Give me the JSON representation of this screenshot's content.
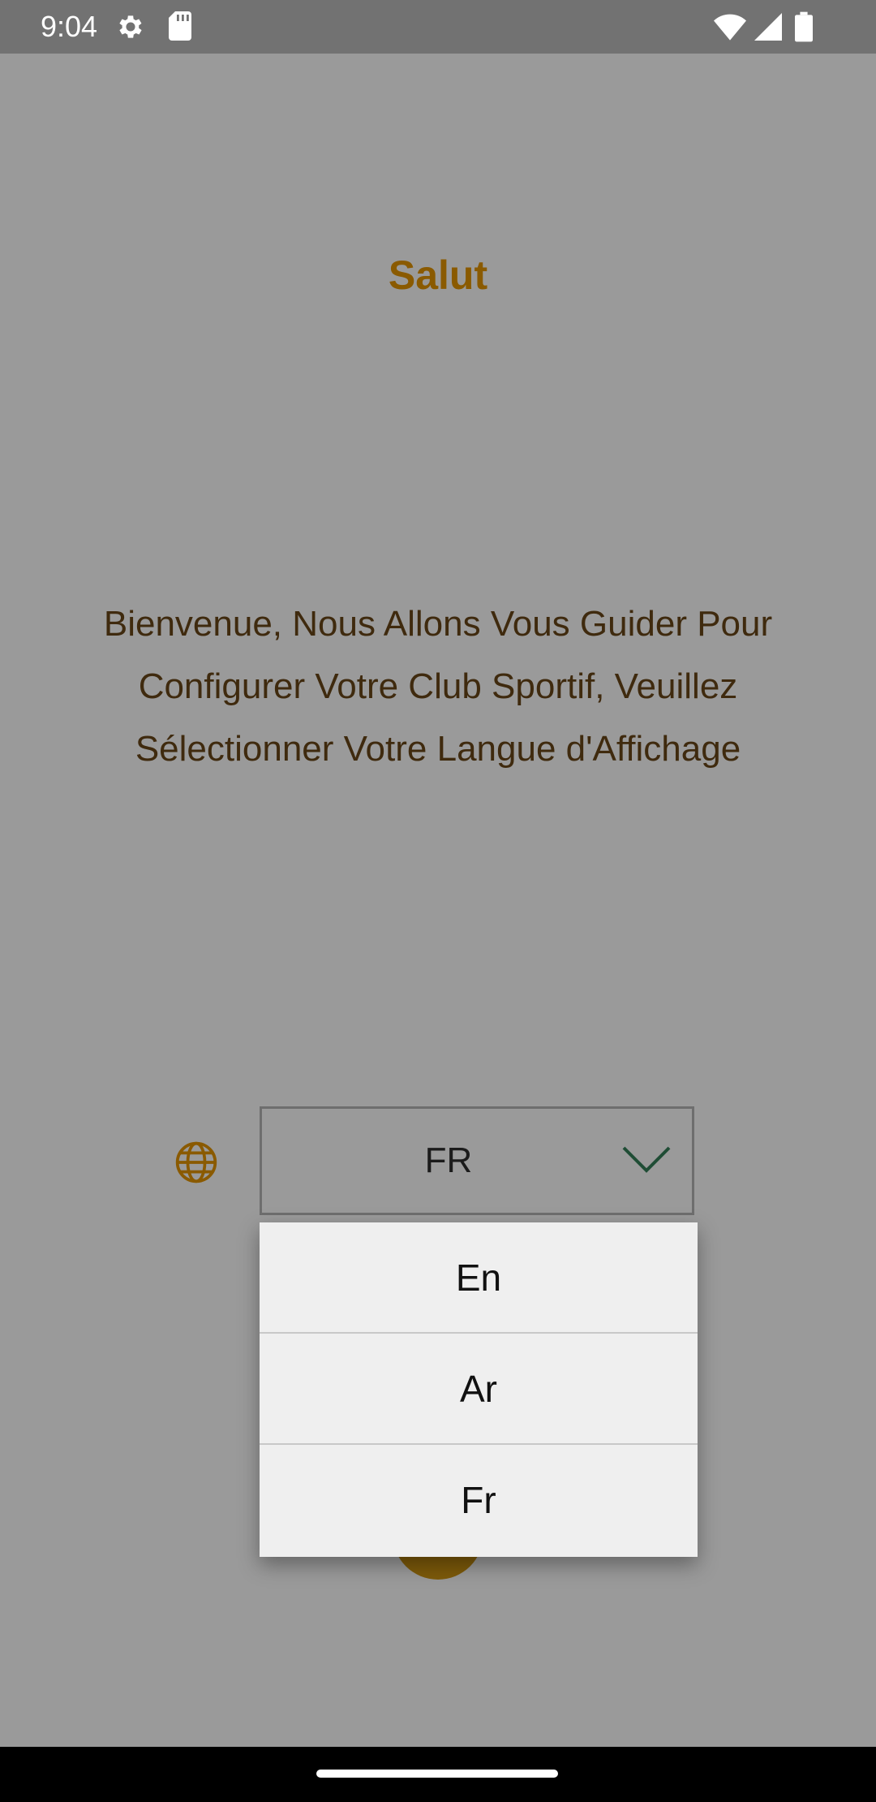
{
  "status_bar": {
    "time": "9:04",
    "icons": [
      "gear-icon",
      "sd-card-icon",
      "wifi-icon",
      "signal-icon",
      "battery-icon"
    ]
  },
  "page": {
    "title": "Salut",
    "intro": "Bienvenue, Nous Allons Vous Guider Pour Configurer Votre Club Sportif, Veuillez Sélectionner Votre Langue d'Affichage"
  },
  "language_select": {
    "icon": "globe-icon",
    "selected": "FR",
    "options": [
      "En",
      "Ar",
      "Fr"
    ]
  },
  "colors": {
    "accent": "#8a5a00",
    "text_dark": "#3f2a0e",
    "scrim": "#9a9a9a",
    "menu_bg": "#efefef"
  }
}
